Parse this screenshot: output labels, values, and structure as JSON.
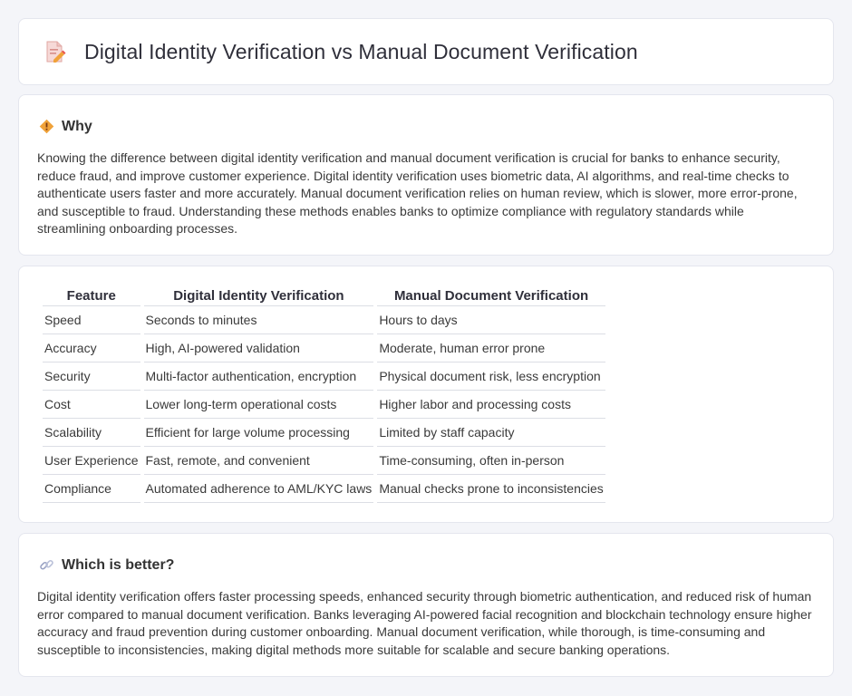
{
  "header": {
    "title": "Digital Identity Verification vs Manual Document Verification",
    "icon": "document-edit-icon"
  },
  "why": {
    "heading": "Why",
    "icon": "diamond-warning-icon",
    "body": "Knowing the difference between digital identity verification and manual document verification is crucial for banks to enhance security, reduce fraud, and improve customer experience. Digital identity verification uses biometric data, AI algorithms, and real-time checks to authenticate users faster and more accurately. Manual document verification relies on human review, which is slower, more error-prone, and susceptible to fraud. Understanding these methods enables banks to optimize compliance with regulatory standards while streamlining onboarding processes."
  },
  "table": {
    "headers": [
      "Feature",
      "Digital Identity Verification",
      "Manual Document Verification"
    ],
    "rows": [
      [
        "Speed",
        "Seconds to minutes",
        "Hours to days"
      ],
      [
        "Accuracy",
        "High, AI-powered validation",
        "Moderate, human error prone"
      ],
      [
        "Security",
        "Multi-factor authentication, encryption",
        "Physical document risk, less encryption"
      ],
      [
        "Cost",
        "Lower long-term operational costs",
        "Higher labor and processing costs"
      ],
      [
        "Scalability",
        "Efficient for large volume processing",
        "Limited by staff capacity"
      ],
      [
        "User Experience",
        "Fast, remote, and convenient",
        "Time-consuming, often in-person"
      ],
      [
        "Compliance",
        "Automated adherence to AML/KYC laws",
        "Manual checks prone to inconsistencies"
      ]
    ]
  },
  "better": {
    "heading": "Which is better?",
    "icon": "link-icon",
    "body": "Digital identity verification offers faster processing speeds, enhanced security through biometric authentication, and reduced risk of human error compared to manual document verification. Banks leveraging AI-powered facial recognition and blockchain technology ensure higher accuracy and fraud prevention during customer onboarding. Manual document verification, while thorough, is time-consuming and susceptible to inconsistencies, making digital methods more suitable for scalable and secure banking operations."
  },
  "colors": {
    "background": "#f4f5f9",
    "card": "#ffffff",
    "border": "#e4e6ee",
    "accent_orange": "#f0a23a",
    "accent_red": "#e8554e"
  }
}
